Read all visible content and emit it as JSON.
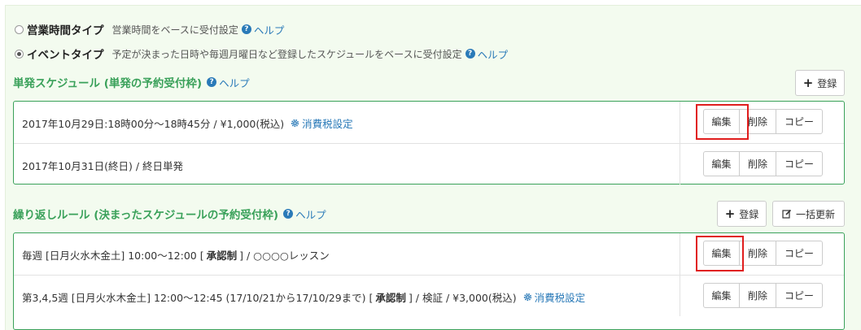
{
  "reception_types": [
    {
      "label": "営業時間タイプ",
      "description": "営業時間をベースに受付設定",
      "help": "ヘルプ",
      "checked": false
    },
    {
      "label": "イベントタイプ",
      "description": "予定が決まった日時や毎週月曜日など登録したスケジュールをベースに受付設定",
      "help": "ヘルプ",
      "checked": true
    }
  ],
  "single": {
    "title": "単発スケジュール (単発の予約受付枠)",
    "help": "ヘルプ",
    "register_label": "登録",
    "rows": [
      {
        "text": "2017年10月29日:18時00分～18時45分  / ¥1,000(税込)",
        "tax_link": "消費税設定"
      },
      {
        "text": "2017年10月31日(終日)  / 終日単発"
      }
    ]
  },
  "recurring": {
    "title": "繰り返しルール (決まったスケジュールの予約受付枠)",
    "help": "ヘルプ",
    "register_label": "登録",
    "bulk_update_label": "一括更新",
    "rows": [
      {
        "pre": "毎週 [日月火水木金土] 10:00～12:00  [",
        "bold": "承認制",
        "post": "]  / ○○○○レッスン"
      },
      {
        "pre": "第3,4,5週 [日月火水木金土] 12:00～12:45  (17/10/21から17/10/29まで)   [",
        "bold": "承認制",
        "post": "]  / 検証  / ¥3,000(税込)",
        "tax_link": "消費税設定"
      }
    ]
  },
  "row_actions": {
    "edit": "編集",
    "delete": "削除",
    "copy": "コピー"
  },
  "icons": {
    "help": "question-circle-icon",
    "plus": "plus-icon",
    "edit": "pencil-square-icon",
    "gear": "gear-icon"
  },
  "colors": {
    "accent_green": "#3aa15a",
    "link_blue": "#2a7ab8",
    "highlight_red": "#e01e1e",
    "panel_bg": "#f3fbef"
  }
}
